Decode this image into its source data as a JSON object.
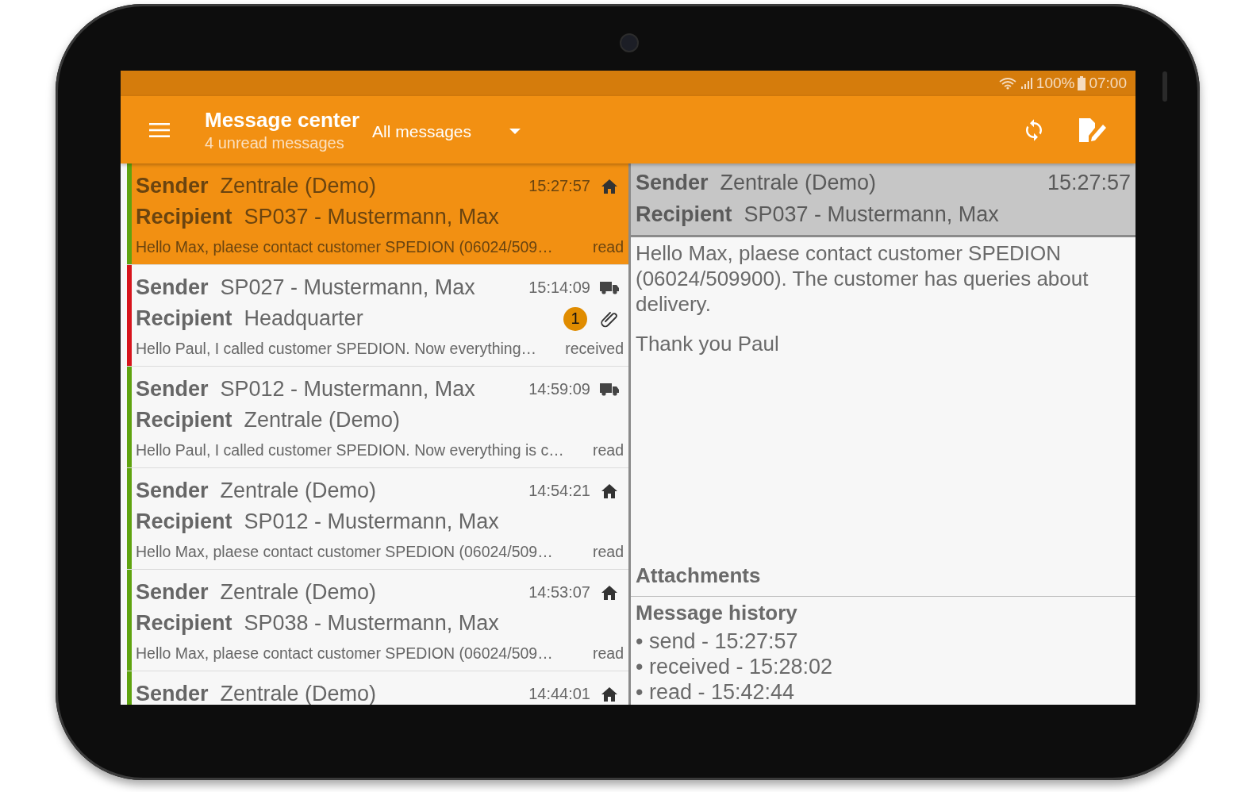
{
  "status_bar": {
    "battery": "100%",
    "time": "07:00"
  },
  "toolbar": {
    "title": "Message center",
    "subtitle": "4 unread messages",
    "filter": "All messages"
  },
  "messages": [
    {
      "sender_label": "Sender",
      "sender": "Zentrale (Demo)",
      "time": "15:27:57",
      "kind": "home",
      "recipient_label": "Recipient",
      "recipient": "SP037 - Mustermann, Max",
      "preview": "Hello Max, plaese contact customer SPEDION (06024/509…",
      "status": "read",
      "color": "#5fa30f",
      "selected": true
    },
    {
      "sender_label": "Sender",
      "sender": "SP027 - Mustermann, Max",
      "time": "15:14:09",
      "kind": "truck",
      "recipient_label": "Recipient",
      "recipient": "Headquarter",
      "badge": "1",
      "attachment": true,
      "preview": "Hello Paul, I called customer SPEDION. Now everything…",
      "status": "received",
      "color": "#d7141c",
      "selected": false
    },
    {
      "sender_label": "Sender",
      "sender": "SP012 - Mustermann, Max",
      "time": "14:59:09",
      "kind": "truck",
      "recipient_label": "Recipient",
      "recipient": "Zentrale (Demo)",
      "preview": "Hello Paul, I called customer SPEDION. Now everything is c…",
      "status": "read",
      "color": "#5fa30f",
      "selected": false
    },
    {
      "sender_label": "Sender",
      "sender": "Zentrale (Demo)",
      "time": "14:54:21",
      "kind": "home",
      "recipient_label": "Recipient",
      "recipient": "SP012 - Mustermann, Max",
      "preview": "Hello Max, plaese contact customer SPEDION (06024/509…",
      "status": "read",
      "color": "#5fa30f",
      "selected": false
    },
    {
      "sender_label": "Sender",
      "sender": "Zentrale (Demo)",
      "time": "14:53:07",
      "kind": "home",
      "recipient_label": "Recipient",
      "recipient": "SP038 - Mustermann, Max",
      "preview": "Hello Max, plaese contact customer SPEDION (06024/509…",
      "status": "read",
      "color": "#5fa30f",
      "selected": false
    },
    {
      "sender_label": "Sender",
      "sender": "Zentrale (Demo)",
      "time": "14:44:01",
      "kind": "home",
      "color": "#5fa30f",
      "selected": false
    }
  ],
  "detail": {
    "sender_label": "Sender",
    "sender": "Zentrale (Demo)",
    "time": "15:27:57",
    "recipient_label": "Recipient",
    "recipient": "SP037 - Mustermann, Max",
    "body": [
      "Hello Max, plaese contact customer SPEDION (06024/509900). The customer has queries about delivery.",
      "Thank you Paul"
    ],
    "attachments_heading": "Attachments",
    "history_heading": "Message history",
    "history": [
      "• send - 15:27:57",
      "• received - 15:28:02",
      "• read - 15:42:44"
    ]
  }
}
